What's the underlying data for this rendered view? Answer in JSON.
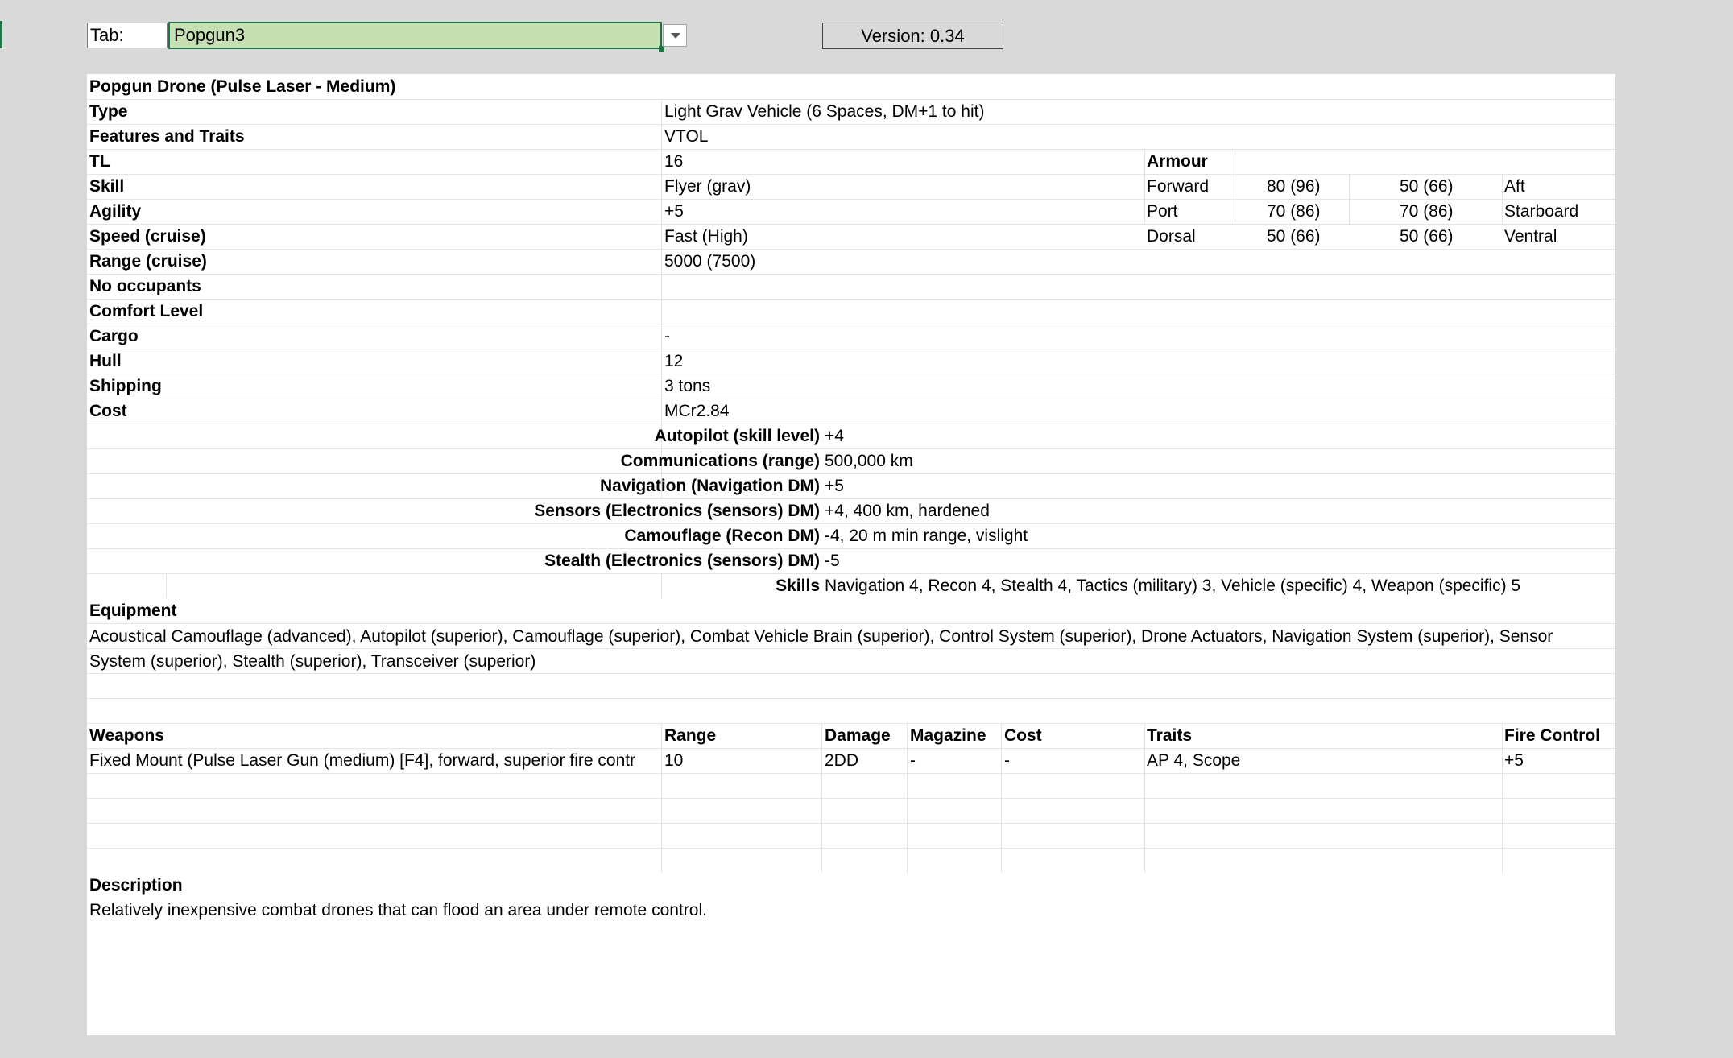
{
  "tab": {
    "label": "Tab:",
    "value": "Popgun3"
  },
  "version": "Version: 0.34",
  "title": "Popgun Drone (Pulse Laser - Medium)",
  "props": [
    {
      "label": "Type",
      "value": "Light Grav Vehicle (6 Spaces, DM+1 to hit)"
    },
    {
      "label": "Features and Traits",
      "value": "VTOL"
    },
    {
      "label": "TL",
      "value": "16"
    },
    {
      "label": "Skill",
      "value": "Flyer (grav)"
    },
    {
      "label": "Agility",
      "value": "+5"
    },
    {
      "label": "Speed (cruise)",
      "value": "Fast (High)"
    },
    {
      "label": "Range (cruise)",
      "value": "5000 (7500)"
    },
    {
      "label": "No occupants",
      "value": ""
    },
    {
      "label": "Comfort Level",
      "value": ""
    },
    {
      "label": "Cargo",
      "value": "-"
    },
    {
      "label": "Hull",
      "value": "12"
    },
    {
      "label": "Shipping",
      "value": "3 tons"
    },
    {
      "label": "Cost",
      "value": "MCr2.84"
    }
  ],
  "armour": {
    "header": "Armour",
    "rows": [
      {
        "a": "Forward",
        "v1": "80 (96)",
        "v2": "50 (66)",
        "b": "Aft"
      },
      {
        "a": "Port",
        "v1": "70 (86)",
        "v2": "70 (86)",
        "b": "Starboard"
      },
      {
        "a": "Dorsal",
        "v1": "50 (66)",
        "v2": "50 (66)",
        "b": "Ventral"
      }
    ]
  },
  "systems": [
    {
      "label": "Autopilot (skill level)",
      "value": "+4"
    },
    {
      "label": "Communications (range)",
      "value": "500,000 km"
    },
    {
      "label": "Navigation (Navigation DM)",
      "value": "+5"
    },
    {
      "label": "Sensors (Electronics (sensors) DM)",
      "value": "+4, 400 km, hardened"
    },
    {
      "label": "Camouflage (Recon DM)",
      "value": "-4, 20 m min range, vislight"
    },
    {
      "label": "Stealth (Electronics (sensors) DM)",
      "value": "-5"
    },
    {
      "label": "Skills",
      "value": "Navigation 4, Recon 4, Stealth 4, Tactics (military) 3, Vehicle (specific) 4, Weapon (specific) 5"
    }
  ],
  "equipment": {
    "header": "Equipment",
    "text": "Acoustical Camouflage (advanced), Autopilot (superior), Camouflage (superior), Combat Vehicle Brain (superior), Control System (superior), Drone Actuators, Navigation System (superior), Sensor System (superior), Stealth (superior), Transceiver (superior)"
  },
  "weapons": {
    "headers": [
      "Weapons",
      "Range",
      "Damage",
      "Magazine",
      "Cost",
      "Traits",
      "Fire Control"
    ],
    "rows": [
      [
        "Fixed Mount (Pulse Laser Gun (medium) [F4], forward, superior fire contr",
        "10",
        "2DD",
        "-",
        "-",
        "AP 4, Scope",
        "+5"
      ]
    ]
  },
  "description": {
    "header": "Description",
    "text": "Relatively inexpensive combat drones that can flood an area under remote control."
  }
}
